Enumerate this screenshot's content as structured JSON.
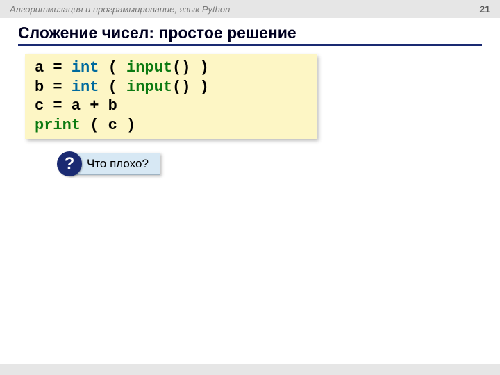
{
  "header": {
    "course": "Алгоритмизация и программирование, язык Python",
    "page": "21"
  },
  "title": "Сложение чисел: простое решение",
  "code": {
    "lines": [
      {
        "pre": "a = ",
        "kw": "int",
        "mid": " ( ",
        "fn": "input",
        "post": "() )"
      },
      {
        "pre": "b = ",
        "kw": "int",
        "mid": " ( ",
        "fn": "input",
        "post": "() )"
      },
      {
        "pre": "c = a + b",
        "kw": "",
        "mid": "",
        "fn": "",
        "post": ""
      },
      {
        "pre": "",
        "kw": "",
        "mid": "",
        "fn": "print",
        "post": " ( c )"
      }
    ]
  },
  "callout": {
    "mark": "?",
    "text": "Что плохо?"
  }
}
